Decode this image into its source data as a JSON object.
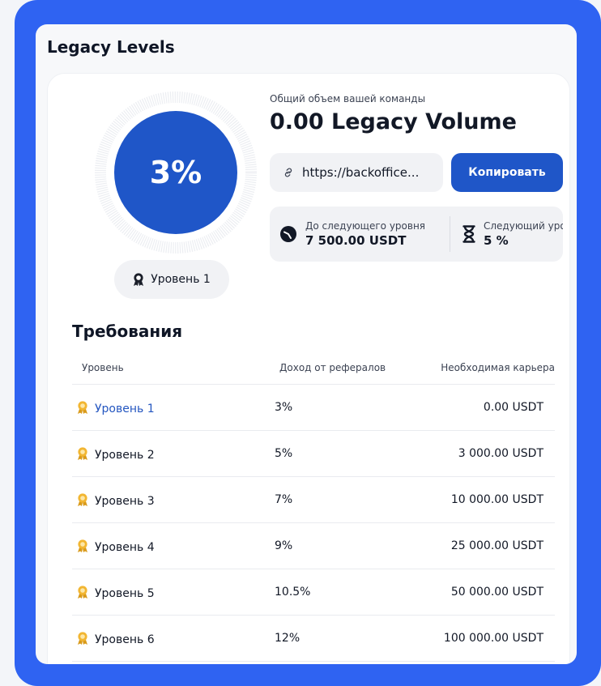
{
  "panel": {
    "title": "Legacy Levels"
  },
  "progress": {
    "percent_label": "3%",
    "fraction": 0.03,
    "ring_color": "#1f56c8"
  },
  "current_level": {
    "label": "Уровень 1"
  },
  "volume": {
    "caption": "Общий объем вашей команды",
    "value": "0.00 Legacy Volume"
  },
  "referral": {
    "link": "https://backoffice...",
    "copy_label": "Копировать"
  },
  "stats": {
    "next_level": {
      "caption": "До следующего уровня",
      "value": "7 500.00 USDT"
    },
    "next_rate": {
      "caption": "Следующий уровень",
      "value": "5 %"
    }
  },
  "requirements": {
    "title": "Требования",
    "headers": {
      "level": "Уровень",
      "income": "Доход от рефералов",
      "career": "Необходимая карьера"
    },
    "rows": [
      {
        "level": "Уровень 1",
        "income": "3%",
        "career": "0.00 USDT"
      },
      {
        "level": "Уровень 2",
        "income": "5%",
        "career": "3 000.00 USDT"
      },
      {
        "level": "Уровень 3",
        "income": "7%",
        "career": "10 000.00 USDT"
      },
      {
        "level": "Уровень 4",
        "income": "9%",
        "career": "25 000.00 USDT"
      },
      {
        "level": "Уровень 5",
        "income": "10.5%",
        "career": "50 000.00 USDT"
      },
      {
        "level": "Уровень 6",
        "income": "12%",
        "career": "100 000.00 USDT"
      }
    ]
  },
  "colors": {
    "frame": "#2f63f2",
    "accent": "#1f56c8",
    "link_active": "#2456c0",
    "medal": "#f2b632"
  }
}
